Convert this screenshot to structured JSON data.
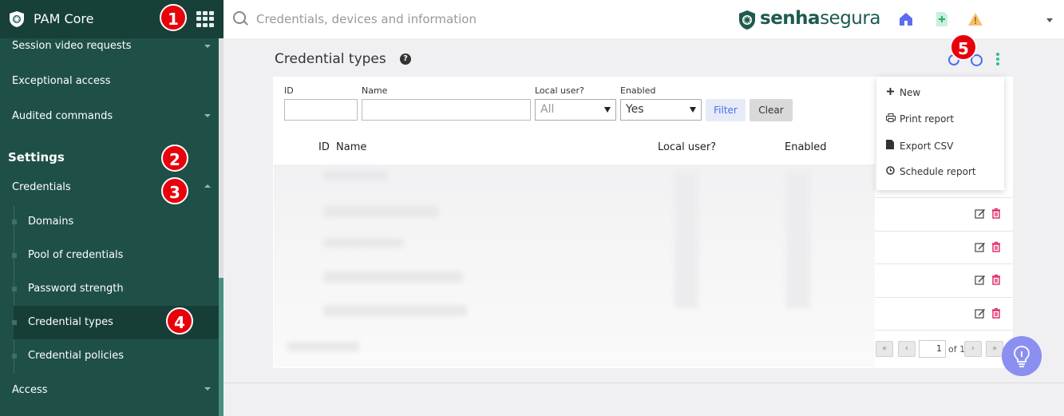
{
  "app": {
    "name": "PAM Core"
  },
  "sidebar": {
    "items_top": [
      {
        "label": "Session video requests"
      },
      {
        "label": "Exceptional access"
      },
      {
        "label": "Audited commands"
      }
    ],
    "settings_heading": "Settings",
    "credentials_label": "Credentials",
    "sub_items": [
      {
        "label": "Domains"
      },
      {
        "label": "Pool of credentials"
      },
      {
        "label": "Password strength"
      },
      {
        "label": "Credential types"
      },
      {
        "label": "Credential policies"
      }
    ],
    "access_label": "Access"
  },
  "badges": [
    "1",
    "2",
    "3",
    "4",
    "5"
  ],
  "topbar": {
    "search_placeholder": "Credentials, devices and information",
    "brand_bold": "senha",
    "brand_rest": "segura"
  },
  "page": {
    "title": "Credential types",
    "help": "?"
  },
  "filters": {
    "id_label": "ID",
    "name_label": "Name",
    "local_user_label": "Local user?",
    "local_user_value": "All",
    "enabled_label": "Enabled",
    "enabled_value": "Yes",
    "filter_button": "Filter",
    "clear_button": "Clear"
  },
  "table": {
    "columns": [
      "ID",
      "Name",
      "Local user?",
      "Enabled"
    ]
  },
  "menu": {
    "items": [
      {
        "label": "New",
        "icon": "plus-icon"
      },
      {
        "label": "Print report",
        "icon": "print-icon"
      },
      {
        "label": "Export CSV",
        "icon": "file-icon"
      },
      {
        "label": "Schedule report",
        "icon": "clock-icon"
      }
    ]
  },
  "pager": {
    "first": "«",
    "prev": "‹",
    "page": "1",
    "of_text": "of 1",
    "next": "›",
    "last": "»"
  },
  "colors": {
    "sidebar": "#1f5048",
    "accent_blue": "#4a6cf7",
    "badge_red": "#e8000b",
    "brand_green": "#1d5b4f"
  }
}
